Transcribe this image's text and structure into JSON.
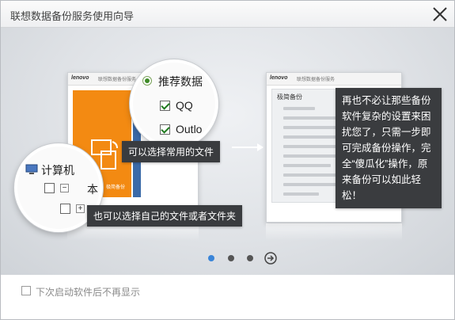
{
  "window": {
    "title": "联想数据备份服务使用向导"
  },
  "left_shot": {
    "brand": "lenovo",
    "subtitle": "联想数据备份服务",
    "tile_label": "极简备份"
  },
  "right_shot": {
    "brand": "lenovo",
    "subtitle": "联想数据备份服务",
    "panel_title": "极简备份"
  },
  "lens_top": {
    "radio_label": "推荐数据",
    "items": [
      "QQ",
      "Outlo"
    ]
  },
  "lens_bottom": {
    "root_label": "计算机",
    "item_label": "本"
  },
  "tooltips": {
    "common_files": "可以选择常用的文件",
    "own_files": "也可以选择自己的文件或者文件夹",
    "description": "再也不必让那些备份软件复杂的设置来困扰您了，只需一步即可完成备份操作，完全“傻瓜化”操作，原来备份可以如此轻松！"
  },
  "pager": {
    "current": 1,
    "total": 3
  },
  "footer": {
    "checkbox_label": "下次启动软件后不再显示",
    "checked": false
  },
  "colors": {
    "accent_dot": "#3a85d8",
    "orange_tile": "#f38a12",
    "tooltip_bg": "#3a3c3f"
  },
  "icons": [
    "close-icon",
    "arrow-right-icon",
    "next-circle-icon",
    "computer-icon",
    "monitor-icon"
  ]
}
